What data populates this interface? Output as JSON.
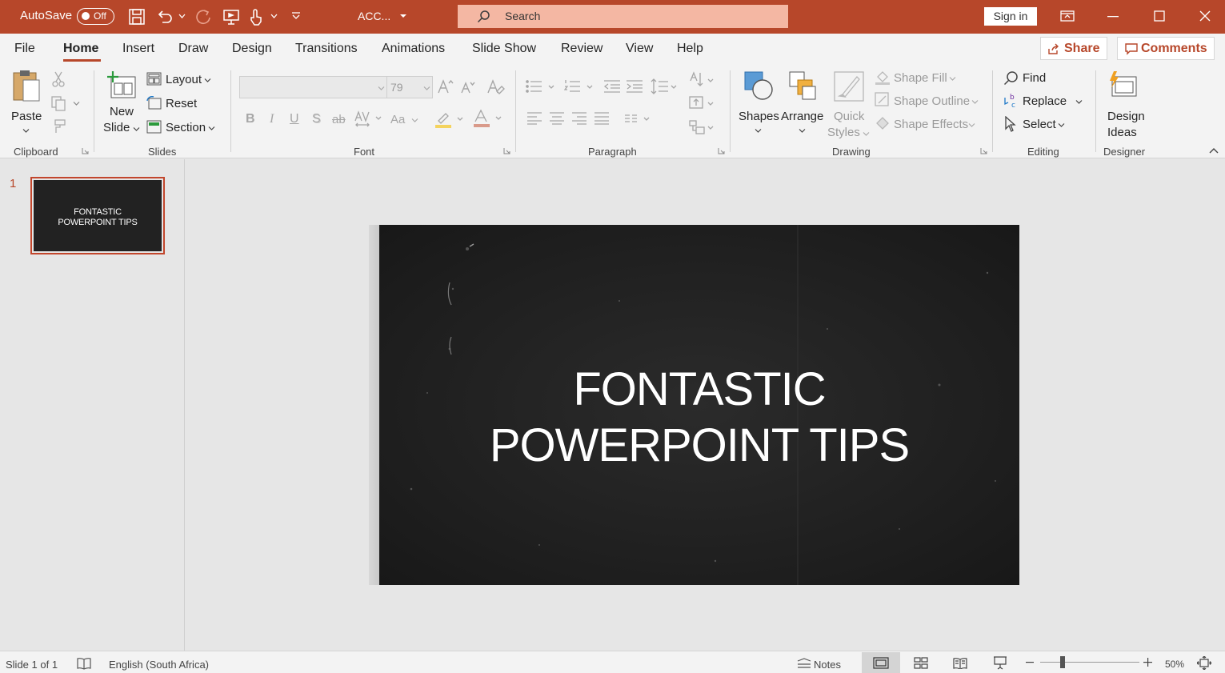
{
  "titlebar": {
    "autosave_label": "AutoSave",
    "autosave_state": "Off",
    "doc_title": "ACC...",
    "search_placeholder": "Search",
    "signin_label": "Sign in"
  },
  "menu": {
    "tabs": [
      "File",
      "Home",
      "Insert",
      "Draw",
      "Design",
      "Transitions",
      "Animations",
      "Slide Show",
      "Review",
      "View",
      "Help"
    ],
    "active": "Home",
    "share_label": "Share",
    "comments_label": "Comments"
  },
  "ribbon": {
    "clipboard": {
      "paste": "Paste",
      "group": "Clipboard"
    },
    "slides": {
      "new_slide_1": "New",
      "new_slide_2": "Slide",
      "layout": "Layout",
      "reset": "Reset",
      "section": "Section",
      "group": "Slides"
    },
    "font": {
      "size": "79",
      "group": "Font"
    },
    "paragraph": {
      "group": "Paragraph"
    },
    "drawing": {
      "shapes": "Shapes",
      "arrange": "Arrange",
      "quick_1": "Quick",
      "quick_2": "Styles",
      "shape_fill": "Shape Fill",
      "shape_outline": "Shape Outline",
      "shape_effects": "Shape Effects",
      "group": "Drawing"
    },
    "editing": {
      "find": "Find",
      "replace": "Replace",
      "select": "Select",
      "group": "Editing"
    },
    "designer": {
      "ideas_1": "Design",
      "ideas_2": "Ideas",
      "group": "Designer"
    }
  },
  "slides": [
    {
      "number": "1",
      "line1": "FONTASTIC",
      "line2": "POWERPOINT TIPS"
    }
  ],
  "slide_main": {
    "line1": "FONTASTIC",
    "line2": "POWERPOINT TIPS"
  },
  "status": {
    "slide_info": "Slide 1 of 1",
    "language": "English (South Africa)",
    "notes_label": "Notes",
    "zoom_label": "50%"
  },
  "colors": {
    "accent": "#b7472a",
    "slide_bg": "#1f1f1f"
  }
}
